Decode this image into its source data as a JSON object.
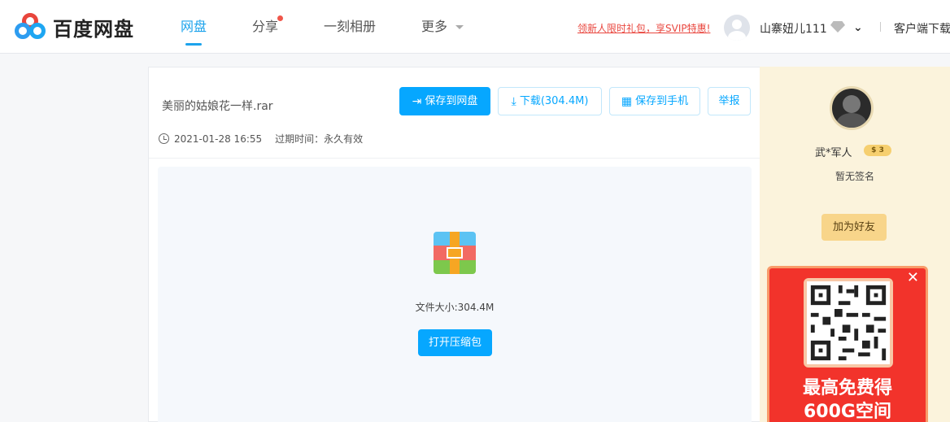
{
  "header": {
    "logo_text": "百度网盘",
    "nav": [
      {
        "label": "网盘",
        "active": true
      },
      {
        "label": "分享",
        "has_dot": true
      },
      {
        "label": "一刻相册"
      },
      {
        "label": "更多"
      }
    ],
    "promo": "领新人限时礼包，享SVIP特惠!",
    "username": "山寨妞儿111",
    "client_download": "客户端下载"
  },
  "share": {
    "filename": "美丽的姑娘花一样.rar",
    "buttons": {
      "save_to_disk": "保存到网盘",
      "download": "下载(304.4M)",
      "save_to_phone": "保存到手机",
      "report": "举报"
    },
    "date": "2021-01-28 16:55",
    "expire": "过期时间：永久有效",
    "file_size": "文件大小:304.4M",
    "open_archive": "打开压缩包"
  },
  "sharer": {
    "name": "武*军人",
    "level": "3",
    "signature": "暂无签名",
    "add_friend": "加为好友"
  },
  "ad": {
    "line1": "最高免费得",
    "line2": "600G空间"
  },
  "colors": {
    "accent": "#06a7ff",
    "promo_red": "#e9473f",
    "sidebar_bg": "#fbf3dc",
    "ad_red": "#f2332b"
  }
}
